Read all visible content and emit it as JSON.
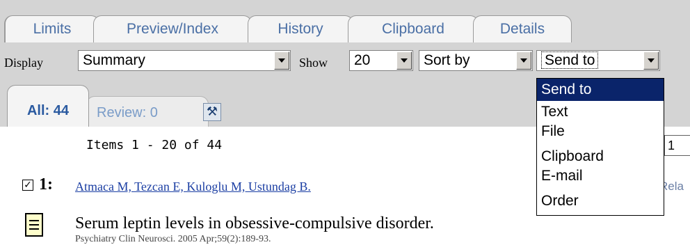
{
  "tabs": [
    "Limits",
    "Preview/Index",
    "History",
    "Clipboard",
    "Details"
  ],
  "toolbar": {
    "display_label": "Display",
    "display_value": "Summary",
    "show_label": "Show",
    "show_value": "20",
    "sort_value": "Sort by",
    "send_value": "Send to"
  },
  "subtabs": {
    "all": "All: 44",
    "review": "Review: 0"
  },
  "results": {
    "range": "Items 1 - 20 of 44",
    "page_value": "1"
  },
  "item": {
    "number": "1:",
    "authors": "Atmaca M, Tezcan E, Kuloglu M, Ustundag B.",
    "related": "Rela",
    "title": "Serum leptin levels in obsessive-compulsive disorder.",
    "cut_line": "Psychiatry Clin Neurosci. 2005 Apr;59(2):189-93."
  },
  "send_menu": [
    "Send to",
    "Text",
    "File",
    "Clipboard",
    "E-mail",
    "Order"
  ],
  "colors": {
    "selected": "#0a246a",
    "link": "#1b3ea3",
    "bg": "#d4d4d4"
  },
  "icons": {
    "tool": "tools-icon",
    "doc": "document-icon"
  }
}
